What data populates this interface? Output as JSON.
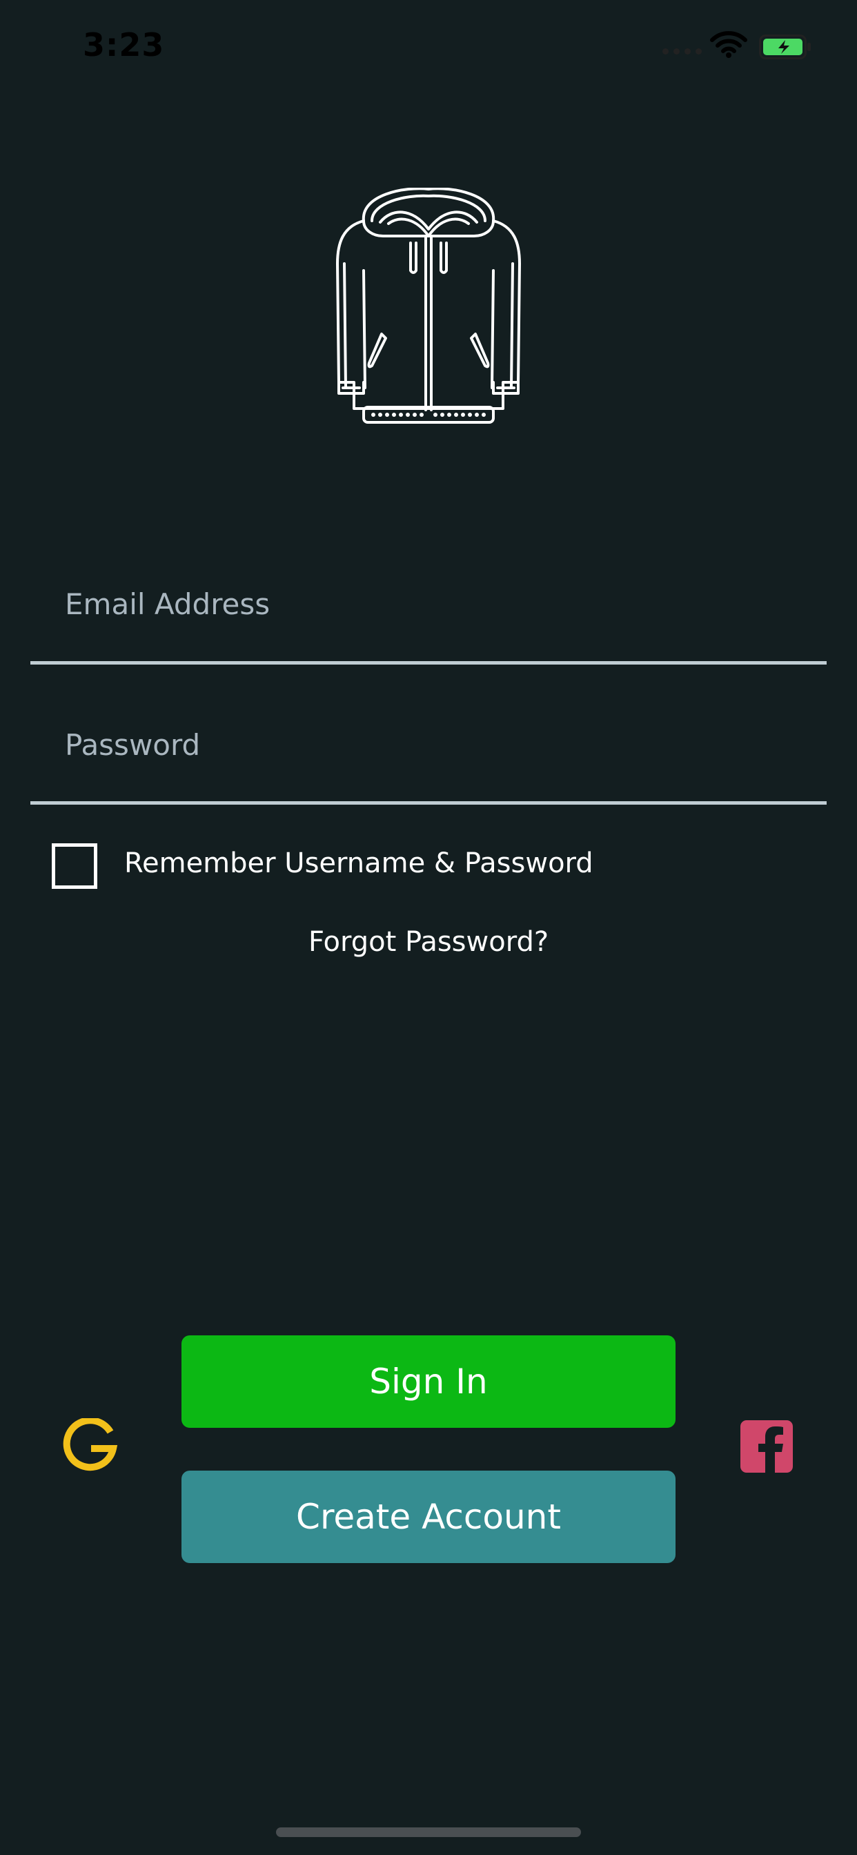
{
  "status_bar": {
    "time": "3:23",
    "icons": [
      "signal-icon",
      "wifi-icon",
      "battery-charging-icon"
    ]
  },
  "logo": {
    "icon": "hoodie-icon"
  },
  "form": {
    "email": {
      "placeholder": "Email Address",
      "value": ""
    },
    "password": {
      "placeholder": "Password",
      "value": ""
    },
    "remember": {
      "label": "Remember Username & Password",
      "checked": false
    },
    "forgot_label": "Forgot Password?"
  },
  "buttons": {
    "sign_in": "Sign In",
    "create_account": "Create Account"
  },
  "social": {
    "google_icon": "google-icon",
    "facebook_icon": "facebook-icon"
  },
  "colors": {
    "background": "#131e20",
    "sign_in": "#0cb814",
    "create_account": "#358d91",
    "google": "#f2c01a",
    "facebook": "#d0476a",
    "underline": "#c0cdd3"
  }
}
